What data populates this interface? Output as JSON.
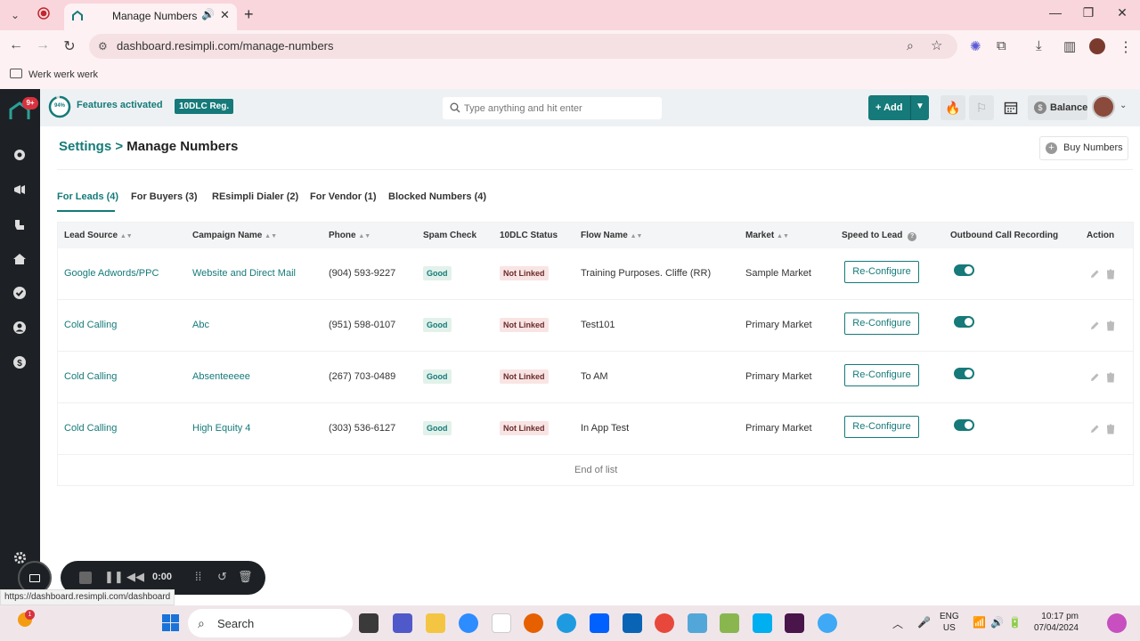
{
  "browser": {
    "tab_title": "Manage Numbers",
    "url": "dashboard.resimpli.com/manage-numbers",
    "bookmark": "Werk werk werk",
    "status_url": "https://dashboard.resimpli.com/dashboard"
  },
  "header": {
    "progress_text": "94%",
    "progress": 0.94,
    "features_text": "Features activated",
    "badge": "10DLC Reg.",
    "search_placeholder": "Type anything and hit enter",
    "add_label": "Add",
    "balance_label": "Balance",
    "notif_count": "9+"
  },
  "page": {
    "breadcrumb_link": "Settings",
    "breadcrumb_sep": ">",
    "breadcrumb_current": "Manage Numbers",
    "buy_label": "Buy Numbers"
  },
  "tabs": [
    {
      "label": "For Leads (4)"
    },
    {
      "label": "For Buyers (3)"
    },
    {
      "label": "REsimpli Dialer (2)"
    },
    {
      "label": "For Vendor (1)"
    },
    {
      "label": "Blocked Numbers (4)"
    }
  ],
  "table": {
    "headers": {
      "lead_source": "Lead Source",
      "campaign": "Campaign Name",
      "phone": "Phone",
      "spam": "Spam Check",
      "dlc": "10DLC Status",
      "flow": "Flow Name",
      "market": "Market",
      "speed": "Speed to Lead",
      "recording": "Outbound Call Recording",
      "action": "Action"
    },
    "rows": [
      {
        "lead_source": "Google Adwords/PPC",
        "campaign": "Website and Direct Mail",
        "phone": "(904) 593-9227",
        "spam": "Good",
        "dlc": "Not Linked",
        "flow": "Training Purposes. Cliffe (RR)",
        "market": "Sample Market",
        "button": "Re-Configure",
        "recording": true
      },
      {
        "lead_source": "Cold Calling",
        "campaign": "Abc",
        "phone": "(951) 598-0107",
        "spam": "Good",
        "dlc": "Not Linked",
        "flow": "Test101",
        "market": "Primary Market",
        "button": "Re-Configure",
        "recording": true
      },
      {
        "lead_source": "Cold Calling",
        "campaign": "Absenteeeee",
        "phone": "(267) 703-0489",
        "spam": "Good",
        "dlc": "Not Linked",
        "flow": "To AM",
        "market": "Primary Market",
        "button": "Re-Configure",
        "recording": true
      },
      {
        "lead_source": "Cold Calling",
        "campaign": "High Equity 4",
        "phone": "(303) 536-6127",
        "spam": "Good",
        "dlc": "Not Linked",
        "flow": "In App Test",
        "market": "Primary Market",
        "button": "Re-Configure",
        "recording": true
      }
    ],
    "end_text": "End of list"
  },
  "recorder": {
    "time": "0:00"
  },
  "taskbar": {
    "search_label": "Search",
    "lang_line1": "ENG",
    "lang_line2": "US",
    "time": "10:17 pm",
    "date": "07/04/2024",
    "notif_count": "1"
  },
  "colors": {
    "accent": "#157a79",
    "sidebar": "#1d2125",
    "tabbar": "#f9d6dc"
  }
}
